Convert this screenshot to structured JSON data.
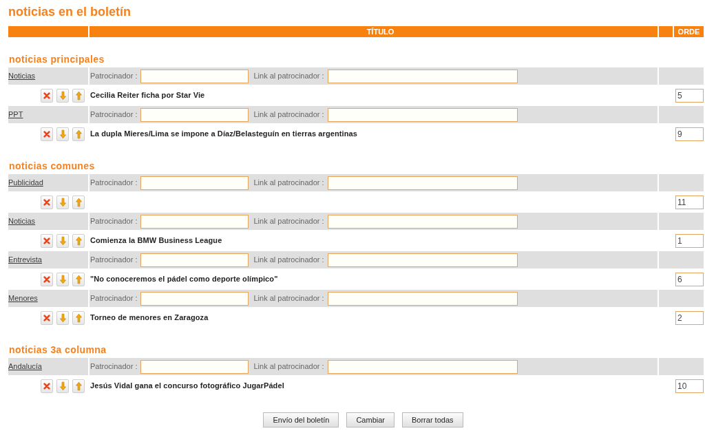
{
  "page": {
    "title": "noticias en el boletín"
  },
  "table_header": {
    "title": "TÍTULO",
    "column_4": "ORDE"
  },
  "sections": [
    {
      "heading": "noticias principales",
      "items": [
        {
          "category": "Noticias",
          "sponsor_label": "Patrocinador :",
          "sponsor_link_label": "Link al patrocinador :",
          "news_title": "Cecilia Reiter ficha por Star Vie",
          "order": "5"
        },
        {
          "category": "PPT",
          "sponsor_label": "Patrocinador :",
          "sponsor_link_label": "Link al patrocinador :",
          "news_title": "La dupla Mieres/Lima se impone a Díaz/Belasteguín en tierras argentinas",
          "order": "9"
        }
      ]
    },
    {
      "heading": "noticias comunes",
      "items": [
        {
          "category": "Publicidad",
          "sponsor_label": "Patrocinador :",
          "sponsor_link_label": "Link al patrocinador :",
          "order": "11"
        },
        {
          "category": "Noticias",
          "sponsor_label": "Patrocinador :",
          "sponsor_link_label": "Link al patrocinador :",
          "news_title": "Comienza la BMW Business League",
          "order": "1"
        },
        {
          "category": "Entrevista",
          "sponsor_label": "Patrocinador :",
          "sponsor_link_label": "Link al patrocinador :",
          "news_title": "\"No conoceremos el pádel como deporte olímpico\"",
          "order": "6"
        },
        {
          "category": "Menores",
          "sponsor_label": "Patrocinador :",
          "sponsor_link_label": "Link al patrocinador :",
          "news_title": "Torneo de menores en Zaragoza",
          "order": "2"
        }
      ]
    },
    {
      "heading": "noticias 3a columna",
      "items": [
        {
          "category": "Andalucía",
          "sponsor_label": "Patrocinador :",
          "sponsor_link_label": "Link al patrocinador :",
          "news_title": "Jesús Vidal gana el concurso fotográfico JugarPádel",
          "order": "10"
        }
      ]
    }
  ],
  "buttons": [
    "Envío del boletín",
    "Cambiar",
    "Borrar todas"
  ]
}
